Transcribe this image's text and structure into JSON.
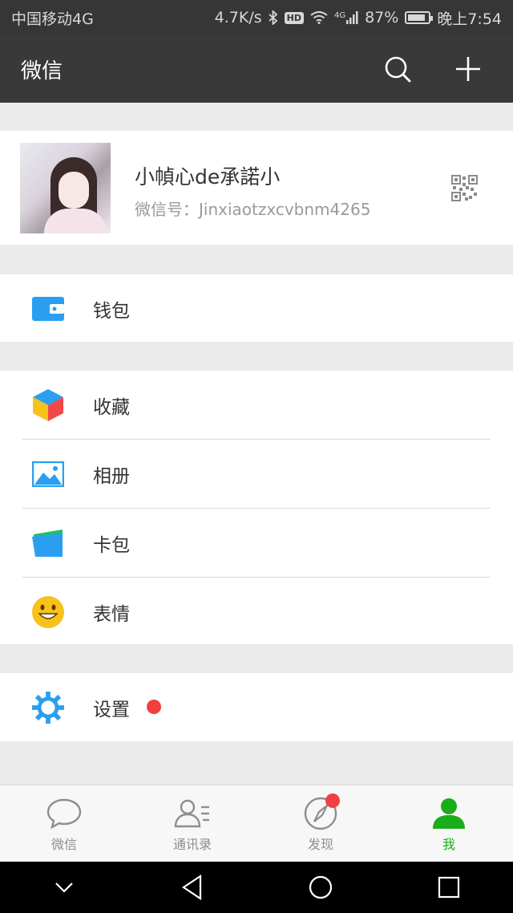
{
  "status_bar": {
    "carrier": "中国移动4G",
    "speed": "4.7K/s",
    "hd": "HD",
    "network": "4G",
    "battery": "87%",
    "battery_level": 0.87,
    "time": "晚上7:54"
  },
  "header": {
    "title": "微信",
    "search_icon": "search-icon",
    "add_icon": "plus-icon"
  },
  "profile": {
    "nickname": "小幀心de承諾小",
    "wechat_id": "微信号：Jinxiaotzxcvbnm4265",
    "qr_icon": "qr-code-icon"
  },
  "menu": {
    "wallet": {
      "label": "钱包",
      "icon": "wallet-icon",
      "color": "#2a9ff0"
    },
    "items": [
      {
        "label": "收藏",
        "icon": "favorites-cube-icon"
      },
      {
        "label": "相册",
        "icon": "album-icon",
        "color": "#2a9ff0"
      },
      {
        "label": "卡包",
        "icon": "card-pack-icon",
        "color": "#2a9ff0"
      },
      {
        "label": "表情",
        "icon": "sticker-smile-icon",
        "color": "#f8c21a"
      }
    ],
    "settings": {
      "label": "设置",
      "icon": "settings-gear-icon",
      "color": "#2a9ff0",
      "has_badge": true
    }
  },
  "tabbar": {
    "tabs": [
      {
        "label": "微信",
        "icon": "chat-bubble-icon",
        "active": false
      },
      {
        "label": "通讯录",
        "icon": "contacts-icon",
        "active": false
      },
      {
        "label": "发现",
        "icon": "compass-icon",
        "active": false,
        "badge": true
      },
      {
        "label": "我",
        "icon": "me-person-icon",
        "active": true
      }
    ],
    "active_color": "#1aad19"
  },
  "system_nav": {
    "buttons": [
      "collapse-icon",
      "back-icon",
      "home-icon",
      "recents-icon"
    ]
  }
}
